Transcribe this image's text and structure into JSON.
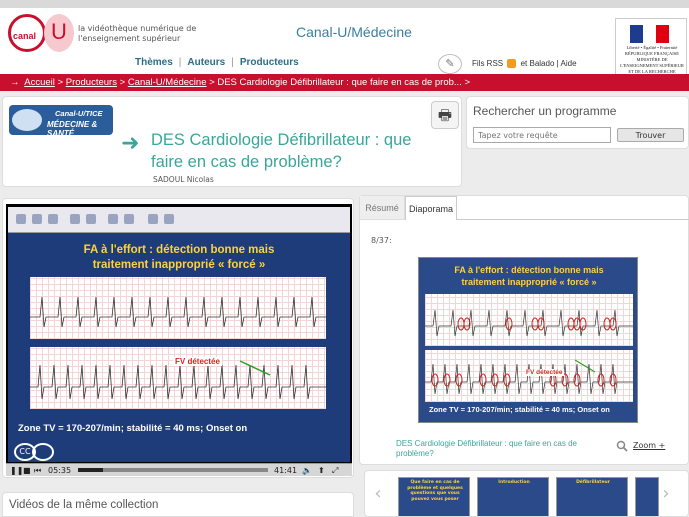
{
  "header": {
    "logo_canal": "canal",
    "logo_u": "U",
    "tagline": "la vidéothèque numérique de l'enseignement supérieur",
    "site_title": "Canal-U/Médecine",
    "nav": [
      "Thèmes",
      "Auteurs",
      "Producteurs"
    ],
    "links": {
      "rss": "Fils RSS",
      "balado": "et Balado",
      "aide": "Aide"
    },
    "ministry": "Liberté • Égalité • Fraternité RÉPUBLIQUE FRANÇAISE MINISTÈRE DE L'ENSEIGNEMENT SUPÉRIEUR ET DE LA RECHERCHE"
  },
  "breadcrumb": {
    "arrow": "→",
    "items": [
      "Accueil",
      "Producteurs",
      "Canal-U/Médecine"
    ],
    "sep": ">",
    "current": "DES Cardiologie Défibrillateur : que faire en cas de prob... >"
  },
  "program": {
    "badge_line1": "Canal-U/TICE",
    "badge_line2": "MÉDECINE & SANTÉ",
    "title": "DES Cardiologie Défibrillateur : que faire en cas de problème?",
    "author": "SADOUL Nicolas",
    "print_icon": "printer-icon"
  },
  "search": {
    "heading": "Rechercher un programme",
    "placeholder": "Tapez votre requête",
    "button": "Trouver"
  },
  "video": {
    "slide_title_line1": "FA à l'effort : détection bonne mais",
    "slide_title_line2": "traitement inapproprié « forcé »",
    "fv_label": "FV détectée",
    "caption": "Zone TV = 170-207/min; stabilité = 40 ms; Onset on",
    "cc": "CC",
    "time_current": "05:35",
    "time_total": "41:41",
    "progress": 0.13
  },
  "tabs": {
    "resume": "Résumé",
    "diaporama": "Diaporama"
  },
  "diaporama": {
    "counter": "8/37:",
    "slide_link": "DES Cardiologie Défibrillateur : que faire en cas de problème?",
    "zoom": "Zoom +"
  },
  "carousel": {
    "prev": "‹",
    "next": "›",
    "thumbs": [
      "Que faire en cas de problème et quelques questions que vous pouvez vous poser",
      "Introduction",
      "Défibrillateur",
      ""
    ]
  },
  "collection": {
    "heading": "Vidéos de la même collection"
  },
  "colors": {
    "brand_red": "#c8102e",
    "teal": "#3aa69a",
    "slide_blue": "#1e3c7a"
  }
}
